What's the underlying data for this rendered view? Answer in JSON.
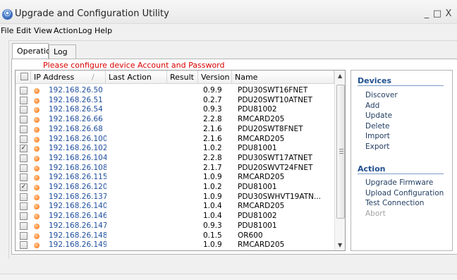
{
  "app": {
    "title": "Upgrade and Configuration Utility",
    "window_controls": [
      "_",
      "□",
      "X"
    ]
  },
  "menu": [
    "File",
    "Edit",
    "View",
    "Action",
    "Log",
    "Help"
  ],
  "tabs": [
    {
      "label": "Operation",
      "selected": true
    },
    {
      "label": "Log",
      "selected": false
    }
  ],
  "warning": "Please configure device Account and Password",
  "grid": {
    "columns": [
      "IP Address",
      "Last Action",
      "Result",
      "Version",
      "Name"
    ],
    "sort_indicator": "/",
    "rows": [
      {
        "checked": false,
        "ip": "192.168.26.50",
        "last_action": "",
        "result": "",
        "version": "0.9.9",
        "name": "PDU30SWT16FNET"
      },
      {
        "checked": false,
        "ip": "192.168.26.51",
        "last_action": "",
        "result": "",
        "version": "0.2.7",
        "name": "PDU20SWT10ATNET"
      },
      {
        "checked": false,
        "ip": "192.168.26.54",
        "last_action": "",
        "result": "",
        "version": "0.9.3",
        "name": "PDU81002"
      },
      {
        "checked": false,
        "ip": "192.168.26.66",
        "last_action": "",
        "result": "",
        "version": "2.2.8",
        "name": "RMCARD205"
      },
      {
        "checked": false,
        "ip": "192.168.26.68",
        "last_action": "",
        "result": "",
        "version": "2.1.6",
        "name": "PDU20SWT8FNET"
      },
      {
        "checked": false,
        "ip": "192.168.26.100",
        "last_action": "",
        "result": "",
        "version": "2.1.6",
        "name": "RMCARD205"
      },
      {
        "checked": true,
        "ip": "192.168.26.102",
        "last_action": "",
        "result": "",
        "version": "1.0.2",
        "name": "PDU81001"
      },
      {
        "checked": false,
        "ip": "192.168.26.104",
        "last_action": "",
        "result": "",
        "version": "2.2.8",
        "name": "PDU30SWT17ATNET"
      },
      {
        "checked": false,
        "ip": "192.168.26.108",
        "last_action": "",
        "result": "",
        "version": "2.1.7",
        "name": "PDU20SWVT24FNET"
      },
      {
        "checked": false,
        "ip": "192.168.26.115",
        "last_action": "",
        "result": "",
        "version": "1.0.9",
        "name": "RMCARD205"
      },
      {
        "checked": true,
        "ip": "192.168.26.120",
        "last_action": "",
        "result": "",
        "version": "1.0.2",
        "name": "PDU81001"
      },
      {
        "checked": false,
        "ip": "192.168.26.137",
        "last_action": "",
        "result": "",
        "version": "1.0.9",
        "name": "PDU30SWHVT19ATN..."
      },
      {
        "checked": false,
        "ip": "192.168.26.140",
        "last_action": "",
        "result": "",
        "version": "1.0.4",
        "name": "RMCARD205"
      },
      {
        "checked": false,
        "ip": "192.168.26.146",
        "last_action": "",
        "result": "",
        "version": "1.0.4",
        "name": "PDU81002"
      },
      {
        "checked": false,
        "ip": "192.168.26.147",
        "last_action": "",
        "result": "",
        "version": "0.9.3",
        "name": "PDU81001"
      },
      {
        "checked": false,
        "ip": "192.168.26.148",
        "last_action": "",
        "result": "",
        "version": "0.1.5",
        "name": "OR600"
      },
      {
        "checked": false,
        "ip": "192.168.26.149",
        "last_action": "",
        "result": "",
        "version": "1.0.9",
        "name": "RMCARD205"
      }
    ]
  },
  "panel": {
    "devices_title": "Devices",
    "devices_items": [
      {
        "label": "Discover",
        "enabled": true
      },
      {
        "label": "Add",
        "enabled": true
      },
      {
        "label": "Update",
        "enabled": true
      },
      {
        "label": "Delete",
        "enabled": true
      },
      {
        "label": "Import",
        "enabled": true
      },
      {
        "label": "Export",
        "enabled": true
      }
    ],
    "action_title": "Action",
    "action_items": [
      {
        "label": "Upgrade Firmware",
        "enabled": true
      },
      {
        "label": "Upload Configuration",
        "enabled": true
      },
      {
        "label": "Test Connection",
        "enabled": true
      },
      {
        "label": "Abort",
        "enabled": false
      }
    ]
  },
  "icons": {
    "app": "app-globe-icon",
    "status": "status-dot-icon",
    "scroll_up": "scroll-up-icon",
    "scroll_down": "scroll-down-icon"
  },
  "colors": {
    "ip_link": "#1f4f9e",
    "warning": "#d90000",
    "section_title": "#1f4f8f",
    "status_dot": "#ff6a00"
  }
}
